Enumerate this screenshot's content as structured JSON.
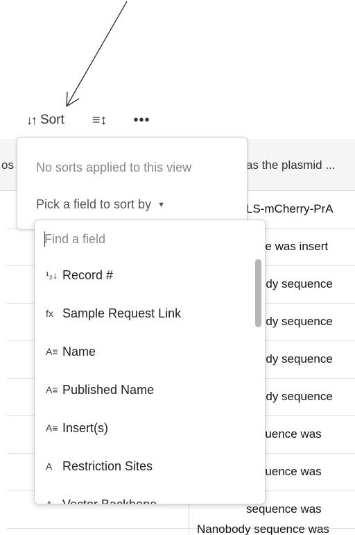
{
  "toolbar": {
    "sort_label": "Sort",
    "sort_icon": "sort-arrows-icon",
    "row_height_icon": "row-height-icon",
    "more_icon": "more-icon"
  },
  "table": {
    "header_left": "os",
    "header_right": "as the plasmid ...",
    "rows": [
      "LS-mCherry-PrA",
      "ence was insert",
      "obody sequence",
      "obody sequence",
      "obody sequence",
      "obody sequence",
      "sequence was",
      "sequence was",
      "sequence was"
    ],
    "last_row": "Nanobody sequence was"
  },
  "sort_popover": {
    "empty_text": "No sorts applied to this view",
    "pick_label": "Pick a field to sort by",
    "caret": "▼"
  },
  "field_dropdown": {
    "search_placeholder": "Find a field",
    "fields": [
      {
        "icon": "autonumber-icon",
        "glyph": "¹₂↓",
        "label": "Record #"
      },
      {
        "icon": "formula-icon",
        "glyph": "fx",
        "label": "Sample Request Link"
      },
      {
        "icon": "long-text-icon",
        "glyph": "A≡",
        "label": "Name"
      },
      {
        "icon": "long-text-icon",
        "glyph": "A≡",
        "label": "Published Name"
      },
      {
        "icon": "long-text-icon",
        "glyph": "A≡",
        "label": "Insert(s)"
      },
      {
        "icon": "single-line-text-icon",
        "glyph": "A",
        "label": "Restriction Sites"
      },
      {
        "icon": "single-line-text-icon",
        "glyph": "A",
        "label": "Vector Backbone"
      }
    ]
  }
}
